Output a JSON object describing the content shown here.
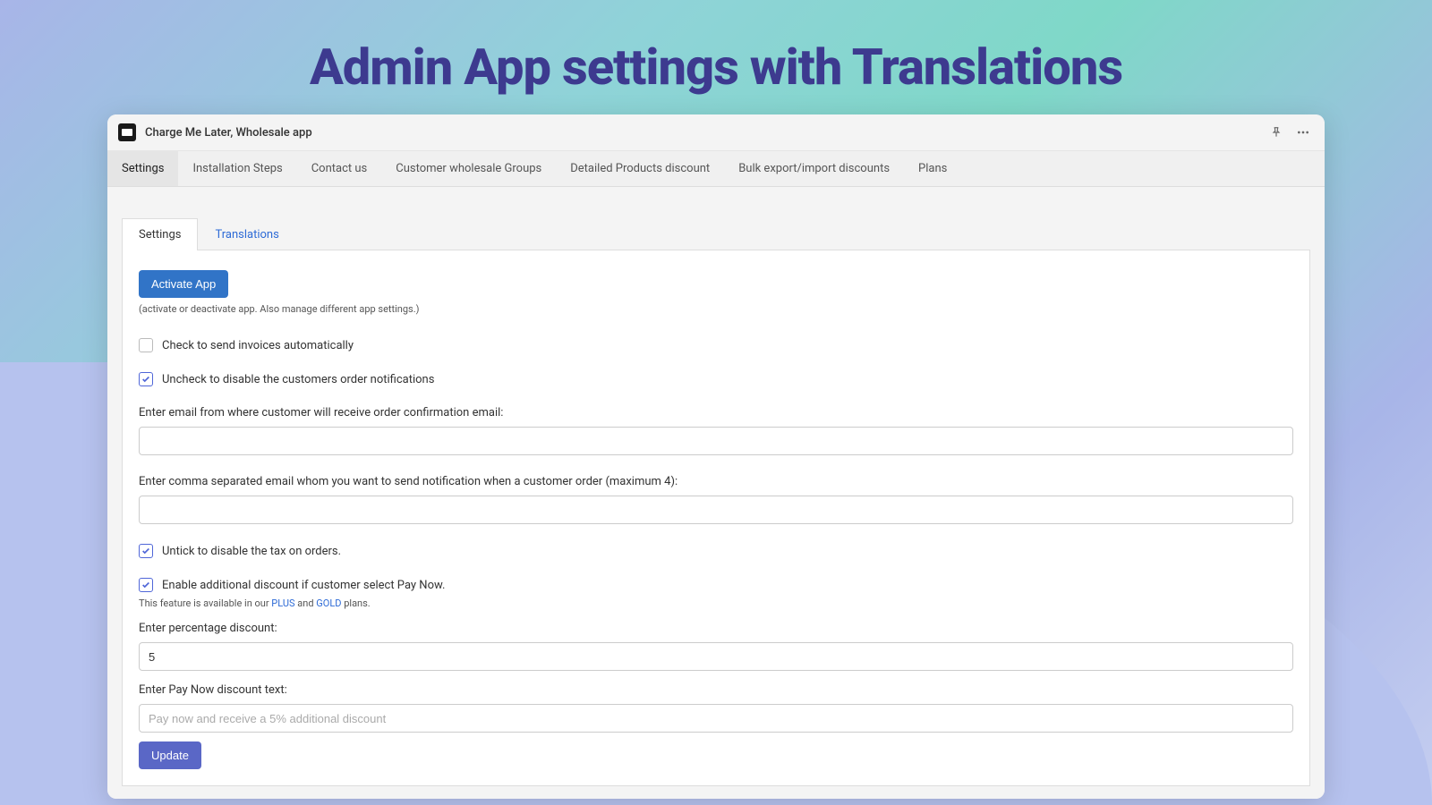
{
  "hero": {
    "title": "Admin App settings with Translations"
  },
  "titlebar": {
    "app_name": "Charge Me Later, Wholesale app"
  },
  "nav": {
    "items": [
      {
        "label": "Settings",
        "active": true
      },
      {
        "label": "Installation Steps"
      },
      {
        "label": "Contact us"
      },
      {
        "label": "Customer wholesale Groups"
      },
      {
        "label": "Detailed Products discount"
      },
      {
        "label": "Bulk export/import discounts"
      },
      {
        "label": "Plans"
      }
    ]
  },
  "subtabs": {
    "settings": "Settings",
    "translations": "Translations"
  },
  "panel": {
    "activate_label": "Activate App",
    "activate_hint": "(activate or deactivate app. Also manage different app settings.)",
    "cb_auto_invoice": "Check to send invoices automatically",
    "cb_order_notify": "Uncheck to disable the customers order notifications",
    "email_from_label": "Enter email from where customer will receive order confirmation email:",
    "email_from_value": "",
    "email_notify_label": "Enter comma separated email whom you want to send notification when a customer order (maximum 4):",
    "email_notify_value": "",
    "cb_tax": "Untick to disable the tax on orders.",
    "cb_paynow_discount": "Enable additional discount if customer select Pay Now.",
    "plan_hint_prefix": "This feature is available in our ",
    "plan_hint_plus": "PLUS",
    "plan_hint_and": " and ",
    "plan_hint_gold": "GOLD",
    "plan_hint_suffix": " plans.",
    "pct_label": "Enter percentage discount:",
    "pct_value": "5",
    "paynow_text_label": "Enter Pay Now discount text:",
    "paynow_text_placeholder": "Pay now and receive a 5% additional discount",
    "paynow_text_value": "",
    "update_label": "Update"
  }
}
